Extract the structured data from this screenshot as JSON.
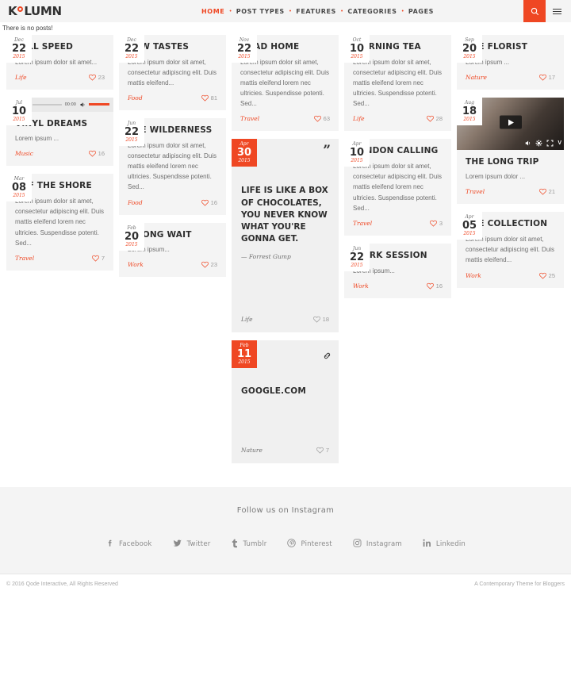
{
  "header": {
    "logo": {
      "pre": "K",
      "ring": "o",
      "post": "LUMN"
    },
    "nav": [
      {
        "label": "HOME",
        "active": true
      },
      {
        "label": "POST TYPES",
        "active": false
      },
      {
        "label": "FEATURES",
        "active": false
      },
      {
        "label": "CATEGORIES",
        "active": false
      },
      {
        "label": "PAGES",
        "active": false
      }
    ],
    "search_icon": "search-icon",
    "menu_icon": "hamburger-icon"
  },
  "notice": {
    "text": "There is no posts!"
  },
  "columns": [
    {
      "cards": [
        {
          "type": "image",
          "date": {
            "month": "Dec",
            "day": "22",
            "year": "2015",
            "orange": false
          },
          "title": "FULL SPEED",
          "excerpt": "Lorem ipsum dolor sit amet...",
          "category": "Life",
          "likes": "23",
          "photo": "ph-1"
        },
        {
          "type": "audio",
          "date": {
            "month": "Jul",
            "day": "10",
            "year": "2015",
            "orange": false
          },
          "title": "VINYL DREAMS",
          "excerpt": "Lorem ipsum ...",
          "category": "Music",
          "likes": "16",
          "photo": "ph-6",
          "audio": {
            "time_current": "00:00",
            "time_total": "00:00"
          }
        },
        {
          "type": "image",
          "date": {
            "month": "Mar",
            "day": "08",
            "year": "2015",
            "orange": false
          },
          "title": "OFF THE SHORE",
          "excerpt": "Lorem ipsum dolor sit amet, consectetur adipiscing elit. Duis mattis eleifend lorem nec ultricies. Suspendisse potenti. Sed...",
          "category": "Travel",
          "likes": "7",
          "photo": "ph-8"
        }
      ]
    },
    {
      "cards": [
        {
          "type": "image",
          "date": {
            "month": "Dec",
            "day": "22",
            "year": "2015",
            "orange": false
          },
          "title": "NEW TASTES",
          "excerpt": "Lorem ipsum dolor sit amet, consectetur adipiscing elit. Duis mattis eleifend...",
          "category": "Food",
          "likes": "81",
          "photo": "ph-2"
        },
        {
          "type": "image",
          "date": {
            "month": "Jun",
            "day": "22",
            "year": "2015",
            "orange": false
          },
          "title": "THE WILDERNESS",
          "excerpt": "Lorem ipsum dolor sit amet, consectetur adipiscing elit. Duis mattis eleifend lorem nec ultricies. Suspendisse potenti. Sed...",
          "category": "Food",
          "likes": "16",
          "photo": "ph-7"
        },
        {
          "type": "image",
          "date": {
            "month": "Feb",
            "day": "20",
            "year": "2015",
            "orange": false
          },
          "title": "A LONG WAIT",
          "excerpt": "Lorem ipsum...",
          "category": "Work",
          "likes": "23",
          "photo": "ph-3"
        }
      ]
    },
    {
      "cards": [
        {
          "type": "image",
          "date": {
            "month": "Nov",
            "day": "22",
            "year": "2015",
            "orange": false
          },
          "title": "ROAD HOME",
          "excerpt": "Lorem ipsum dolor sit amet, consectetur adipiscing elit. Duis mattis eleifend lorem nec ultricies. Suspendisse potenti. Sed...",
          "category": "Travel",
          "likes": "63",
          "photo": "ph-3"
        },
        {
          "type": "quote",
          "date": {
            "month": "Apr",
            "day": "30",
            "year": "2015",
            "orange": true
          },
          "quote": "LIFE IS LIKE A BOX OF CHOCOLATES, YOU NEVER KNOW WHAT YOU'RE GONNA GET.",
          "author": "— Forrest Gump",
          "category": "Life",
          "likes": "18",
          "quote_icon": "quote-mark-icon"
        },
        {
          "type": "link",
          "date": {
            "month": "Feb",
            "day": "11",
            "year": "2015",
            "orange": true
          },
          "url_label": "GOOGLE.COM",
          "category": "Nature",
          "likes": "7",
          "link_icon": "chain-link-icon"
        }
      ]
    },
    {
      "cards": [
        {
          "type": "image",
          "date": {
            "month": "Oct",
            "day": "10",
            "year": "2015",
            "orange": false
          },
          "title": "MORNING TEA",
          "excerpt": "Lorem ipsum dolor sit amet, consectetur adipiscing elit. Duis mattis eleifend lorem nec ultricies. Suspendisse potenti. Sed...",
          "category": "Life",
          "likes": "28",
          "photo": "ph-4"
        },
        {
          "type": "image",
          "date": {
            "month": "Apr",
            "day": "10",
            "year": "2015",
            "orange": false
          },
          "title": "LONDON CALLING",
          "excerpt": "Lorem ipsum dolor sit amet, consectetur adipiscing elit. Duis mattis eleifend lorem nec ultricies. Suspendisse potenti. Sed...",
          "category": "Travel",
          "likes": "3",
          "photo": "ph-9"
        },
        {
          "type": "image",
          "date": {
            "month": "Jun",
            "day": "22",
            "year": "2015",
            "orange": false
          },
          "title": "WORK SESSION",
          "excerpt": "Lorem ipsum...",
          "category": "Work",
          "likes": "16",
          "photo": "ph-12"
        }
      ]
    },
    {
      "cards": [
        {
          "type": "image",
          "date": {
            "month": "Sep",
            "day": "20",
            "year": "2015",
            "orange": false
          },
          "title": "THE FLORIST",
          "excerpt": "Lorem ipsum ...",
          "category": "Nature",
          "likes": "17",
          "photo": "ph-5"
        },
        {
          "type": "video",
          "date": {
            "month": "Aug",
            "day": "18",
            "year": "2015",
            "orange": false
          },
          "title": "THE LONG TRIP",
          "excerpt": "Lorem ipsum dolor ...",
          "category": "Travel",
          "likes": "21",
          "video_controls": [
            "volume-icon",
            "settings-gear-icon",
            "fullscreen-icon",
            "vimeo-icon"
          ]
        },
        {
          "type": "image",
          "date": {
            "month": "Apr",
            "day": "05",
            "year": "2015",
            "orange": false
          },
          "title": "THE COLLECTION",
          "excerpt": "Lorem ipsum dolor sit amet, consectetur adipiscing elit. Duis mattis eleifend...",
          "category": "Work",
          "likes": "25",
          "photo": "ph-14"
        }
      ]
    }
  ],
  "footer": {
    "instagram_title": "Follow us on Instagram",
    "socials": [
      {
        "icon": "facebook-icon",
        "glyph": "f",
        "label": "Facebook"
      },
      {
        "icon": "twitter-icon",
        "glyph": "🐦",
        "label": "Twitter"
      },
      {
        "icon": "tumblr-icon",
        "glyph": "t",
        "label": "Tumblr"
      },
      {
        "icon": "pinterest-icon",
        "glyph": "P",
        "label": "Pinterest"
      },
      {
        "icon": "instagram-icon",
        "glyph": "◻",
        "label": "Instagram"
      },
      {
        "icon": "linkedin-icon",
        "glyph": "in",
        "label": "Linkedin"
      }
    ],
    "copyright": "© 2016 Qode Interactive, All Rights Reserved",
    "tagline": "A Contemporary Theme for Bloggers"
  },
  "colors": {
    "accent": "#ef4723",
    "card_bg": "#f4f4f4",
    "page_bg": "#ffffff"
  }
}
